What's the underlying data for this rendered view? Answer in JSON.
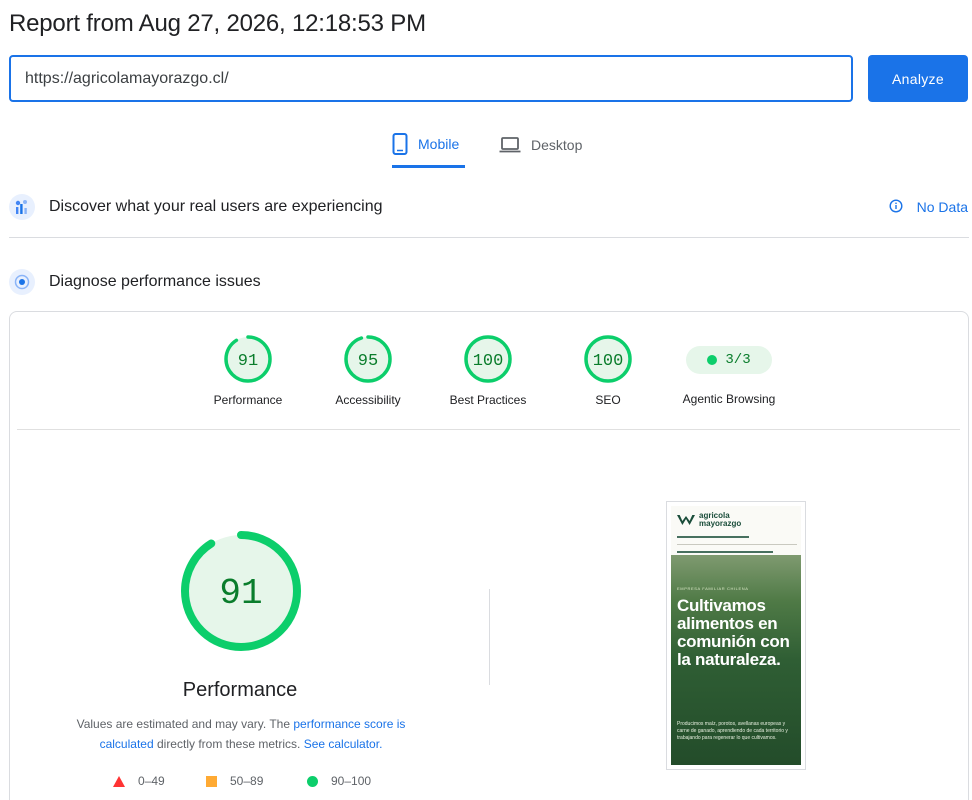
{
  "header": {
    "title": "Report from Aug 27, 2026, 12:18:53 PM"
  },
  "search": {
    "value": "https://agricolamayorazgo.cl/",
    "button_label": "Analyze"
  },
  "tabs": [
    {
      "label": "Mobile",
      "icon": "smartphone-icon",
      "active": true
    },
    {
      "label": "Desktop",
      "icon": "laptop-icon",
      "active": false
    }
  ],
  "crux": {
    "title": "Discover what your real users are experiencing",
    "status": "No Data"
  },
  "diagnose": {
    "title": "Diagnose performance issues"
  },
  "scores": [
    {
      "label": "Performance",
      "value": "91"
    },
    {
      "label": "Accessibility",
      "value": "95"
    },
    {
      "label": "Best Practices",
      "value": "100"
    },
    {
      "label": "SEO",
      "value": "100"
    },
    {
      "label": "Agentic Browsing",
      "value": "3/3"
    }
  ],
  "performance": {
    "score": "91",
    "label": "Performance",
    "note_prefix": "Values are estimated and may vary. The ",
    "note_link1": "performance score is calculated",
    "note_mid": " directly from these metrics. ",
    "note_link2": "See calculator."
  },
  "legend": [
    {
      "shape": "triangle",
      "color": "#ff3333",
      "range": "0–49"
    },
    {
      "shape": "square",
      "color": "#ffaa33",
      "range": "50–89"
    },
    {
      "shape": "circle",
      "color": "#0cce6b",
      "range": "90–100"
    }
  ],
  "screenshot": {
    "brand_line1": "agricola",
    "brand_line2": "mayorazgo",
    "kicker": "EMPRESA FAMILIAR CHILENA",
    "headline": "Cultivamos alimentos en comunión con la naturaleza.",
    "body": "Producimos maíz, porotos, avellanas europeas y carne de ganado, aprendiendo de cada territorio y trabajando para regenerar lo que cultivamos."
  },
  "colors": {
    "accent": "#1a73e8",
    "pass": "#0cce6b",
    "pass_text": "#0a7d2c",
    "pass_fill": "#e6f6ea"
  }
}
